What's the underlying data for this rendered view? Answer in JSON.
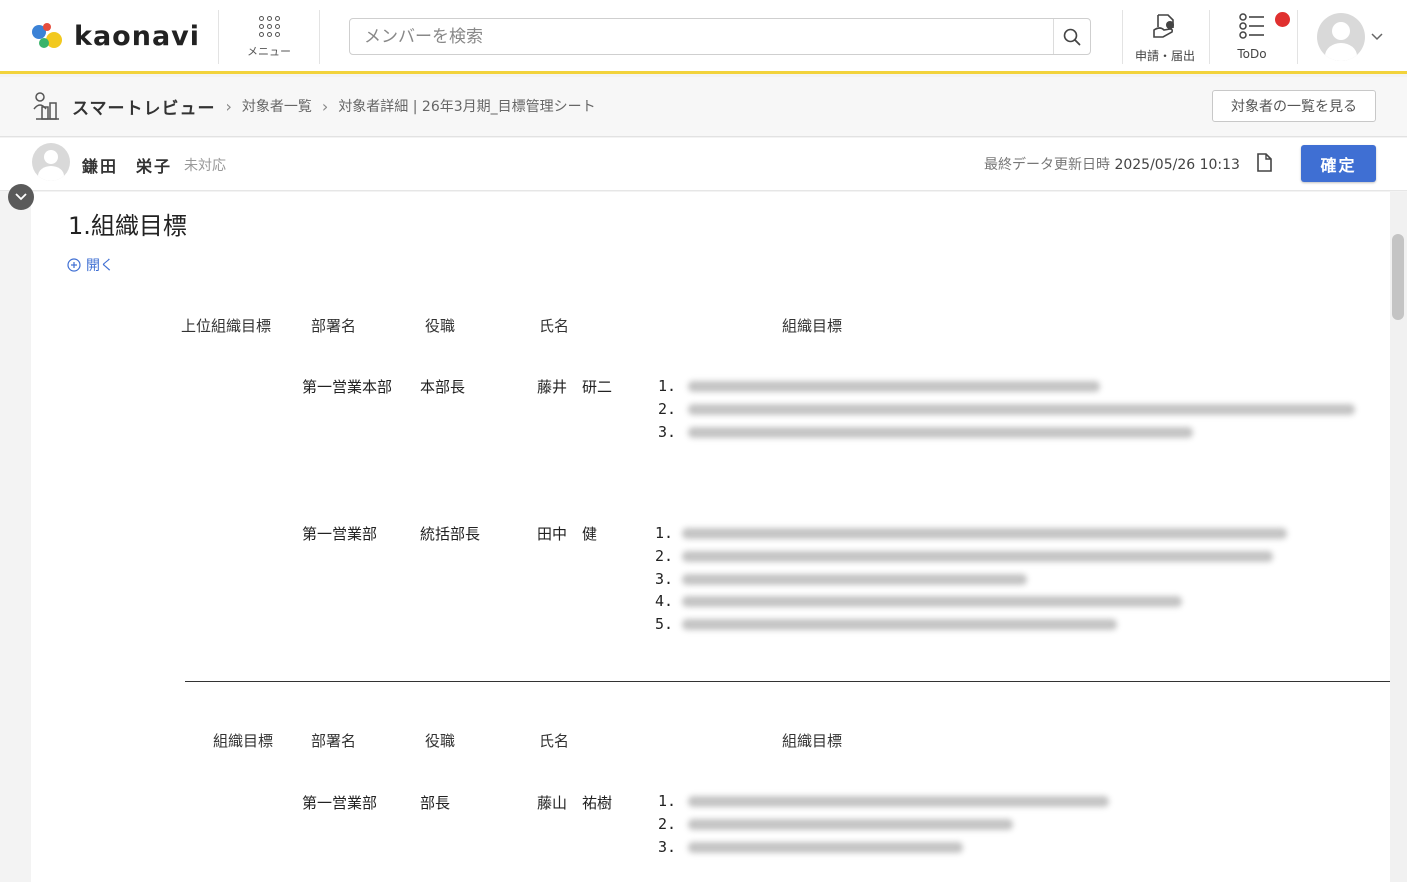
{
  "app": {
    "logo_text": "kaonavi"
  },
  "header": {
    "menu_label": "メニュー",
    "search_placeholder": "メンバーを検索",
    "request_label": "申請・届出",
    "todo_label": "ToDo",
    "notification_color": "#e0302f"
  },
  "breadcrumb": {
    "title": "スマートレビュー",
    "items": [
      "対象者一覧",
      "対象者詳細 | 26年3月期_目標管理シート"
    ],
    "list_button": "対象者の一覧を見る"
  },
  "user": {
    "name": "鎌田　栄子",
    "status": "未対応",
    "update_label": "最終データ更新日時",
    "update_time": "2025/05/26 10:13",
    "confirm_button": "確定"
  },
  "section": {
    "title": "1.組織目標",
    "open_link": "開く",
    "upper_headers": [
      "上位組織目標",
      "部署名",
      "役職",
      "氏名",
      "組織目標"
    ],
    "upper_rows": [
      {
        "dept": "第一営業本部",
        "role": "本部長",
        "name": "藤井　研二",
        "goals": [
          "1.",
          "2.",
          "3."
        ]
      },
      {
        "dept": "第一営業部",
        "role": "統括部長",
        "name": "田中　健",
        "goals": [
          "1.",
          "2.",
          "3.",
          "4.",
          "5."
        ]
      }
    ],
    "org_headers": [
      "組織目標",
      "部署名",
      "役職",
      "氏名",
      "組織目標"
    ],
    "org_rows": [
      {
        "dept": "第一営業部",
        "role": "部長",
        "name": "藤山　祐樹",
        "goals": [
          "1.",
          "2.",
          "3."
        ]
      }
    ]
  },
  "colors": {
    "accent": "#3f6fd3",
    "header_border": "#f2d33c"
  }
}
